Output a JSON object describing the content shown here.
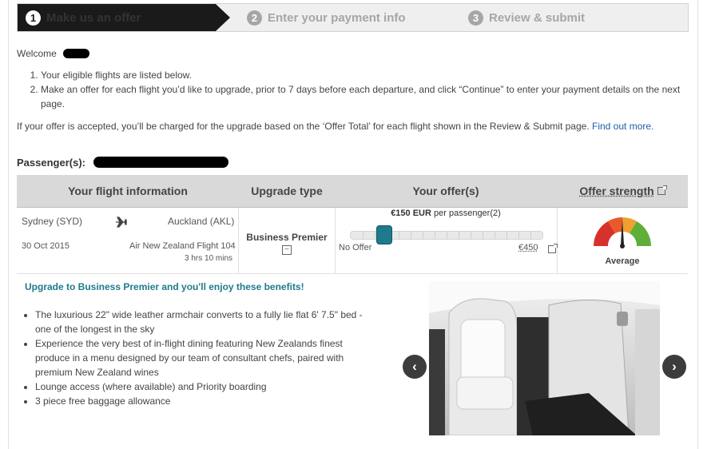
{
  "steps": [
    {
      "num": "1",
      "label": "Make us an offer",
      "state": "active"
    },
    {
      "num": "2",
      "label": "Enter your payment info",
      "state": "inactive"
    },
    {
      "num": "3",
      "label": "Review & submit",
      "state": "inactive"
    }
  ],
  "welcome": "Welcome",
  "instructions": [
    "Your eligible flights are listed below.",
    "Make an offer for each flight you’d like to upgrade, prior to 7 days before each departure, and click “Continue” to enter your payment details on the next page."
  ],
  "notice": {
    "text": "If your offer is accepted, you’ll be charged for the upgrade based on the ‘Offer Total’ for each flight shown in the Review & Submit page.",
    "link": "Find out more."
  },
  "passengers_label": "Passenger(s):",
  "table": {
    "headers": {
      "flight": "Your flight information",
      "upgrade": "Upgrade type",
      "offer": "Your offer(s)",
      "strength": "Offer strength"
    },
    "flight": {
      "origin": "Sydney (SYD)",
      "destination": "Auckland (AKL)",
      "date": "30 Oct 2015",
      "flight_name": "Air New Zealand Flight 104",
      "duration": "3 hrs 10 mins"
    },
    "upgrade_type": "Business Premier",
    "offer": {
      "amount": "€150 EUR",
      "per_passenger": "per passenger(2)",
      "min_label": "No Offer",
      "max_label": "€450",
      "slider_fraction": 0.15
    },
    "strength": {
      "label": "Average",
      "level_fraction": 0.5
    }
  },
  "benefits": {
    "title": "Upgrade to Business Premier and you'll enjoy these benefits!",
    "items": [
      "The luxurious 22\" wide leather armchair converts to a fully lie flat 6' 7.5\" bed - one of the longest in the sky",
      "Experience the very best of in-flight dining featuring New Zealands finest produce in a menu designed by our team of consultant chefs, paired with premium New Zealand wines",
      "Lounge access (where available) and Priority boarding",
      "3 piece free baggage allowance"
    ]
  },
  "carousel": {
    "prev_icon": "‹",
    "next_icon": "›"
  },
  "colors": {
    "accent": "#1e7a8c",
    "link": "#1f5fa8",
    "step_active": "#1a1a1a",
    "gauge_red": "#d7312b",
    "gauge_orange": "#f0a030",
    "gauge_green": "#5fae38"
  }
}
